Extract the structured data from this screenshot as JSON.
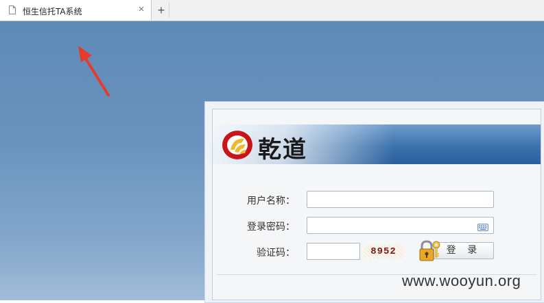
{
  "browser": {
    "tab_title": "恒生信托TA系统",
    "close_symbol": "×",
    "new_tab_symbol": "+"
  },
  "login": {
    "brand": "乾道",
    "username_label": "用户名称：",
    "password_label": "登录密码：",
    "captcha_label": "验证码：",
    "username_value": "",
    "password_value": "",
    "captcha_value": "",
    "captcha_code": "8952",
    "login_button": "登 录"
  },
  "watermark": "www.wooyun.org",
  "colors": {
    "page_bg": "#6a94be",
    "banner": "#3c73ad",
    "arrow": "#e53b2c",
    "logo_red": "#c8141a",
    "logo_gold": "#f0b830"
  }
}
